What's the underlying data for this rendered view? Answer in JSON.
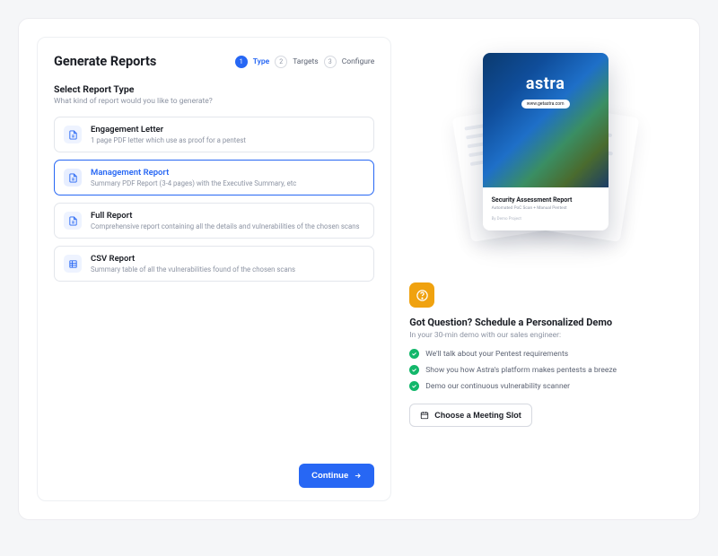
{
  "title": "Generate Reports",
  "steps": [
    {
      "num": "1",
      "label": "Type",
      "active": true
    },
    {
      "num": "2",
      "label": "Targets",
      "active": false
    },
    {
      "num": "3",
      "label": "Configure",
      "active": false
    }
  ],
  "section": {
    "title": "Select Report Type",
    "sub": "What kind of report would you like to generate?"
  },
  "options": [
    {
      "title": "Engagement Letter",
      "desc": "1 page PDF letter which use as proof for a pentest"
    },
    {
      "title": "Management Report",
      "desc": "Summary PDF Report (3-4 pages) with the Executive Summary, etc"
    },
    {
      "title": "Full Report",
      "desc": "Comprehensive report containing all the details and vulnerabilities of the chosen scans"
    },
    {
      "title": "CSV Report",
      "desc": "Summary table of all the vulnerabilities found of the chosen scans"
    }
  ],
  "selectedOption": 1,
  "continue_label": "Continue",
  "preview": {
    "logo": "astra",
    "url_pill": "www.getastra.com",
    "heading": "Security Assessment Report",
    "sub": "Automated PoC Scan + Manual Pentest",
    "by": "By Demo Project"
  },
  "demo": {
    "title": "Got Question? Schedule a Personalized Demo",
    "sub": "In your 30-min demo with our sales engineer:",
    "items": [
      "We'll talk about your Pentest requirements",
      "Show you how Astra's platform makes pentests a breeze",
      "Demo our continuous vulnerability scanner"
    ],
    "button": "Choose a Meeting Slot"
  }
}
